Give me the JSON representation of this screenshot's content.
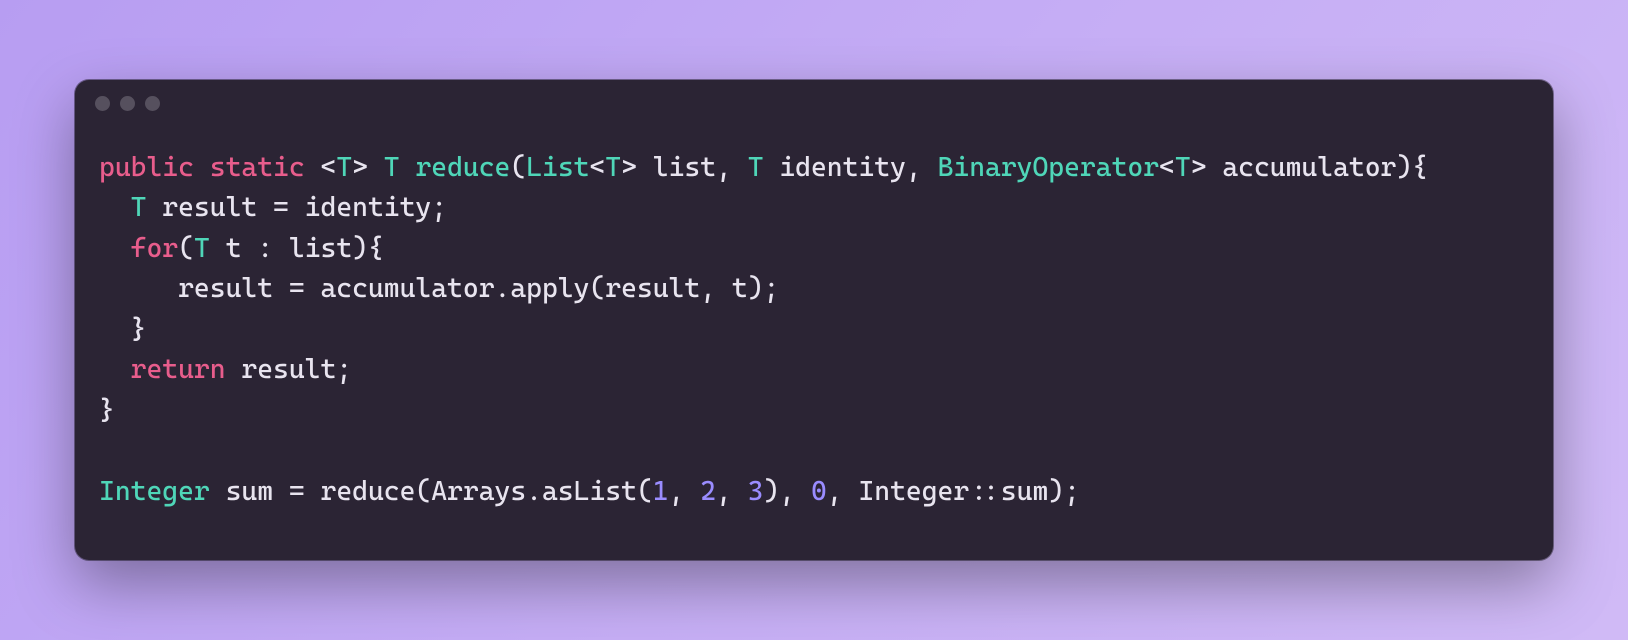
{
  "colors": {
    "bg_gradient_from": "#b79df2",
    "bg_gradient_to": "#d0baf6",
    "window_bg": "#2b2434",
    "dot": "#56505e",
    "text": "#e8e4ef",
    "keyword": "#e85d8c",
    "type": "#4fd6b8",
    "number": "#9a8cff"
  },
  "code": {
    "tokens": [
      [
        {
          "t": "public",
          "c": "keyword"
        },
        {
          "t": " ",
          "c": "plain"
        },
        {
          "t": "static",
          "c": "keyword"
        },
        {
          "t": " <",
          "c": "plain"
        },
        {
          "t": "T",
          "c": "type"
        },
        {
          "t": "> ",
          "c": "plain"
        },
        {
          "t": "T",
          "c": "type"
        },
        {
          "t": " ",
          "c": "plain"
        },
        {
          "t": "reduce",
          "c": "funcname"
        },
        {
          "t": "(",
          "c": "plain"
        },
        {
          "t": "List",
          "c": "type"
        },
        {
          "t": "<",
          "c": "plain"
        },
        {
          "t": "T",
          "c": "type"
        },
        {
          "t": "> list, ",
          "c": "plain"
        },
        {
          "t": "T",
          "c": "type"
        },
        {
          "t": " identity, ",
          "c": "plain"
        },
        {
          "t": "BinaryOperator",
          "c": "type"
        },
        {
          "t": "<",
          "c": "plain"
        },
        {
          "t": "T",
          "c": "type"
        },
        {
          "t": "> accumulator){",
          "c": "plain"
        }
      ],
      [
        {
          "t": "  ",
          "c": "plain"
        },
        {
          "t": "T",
          "c": "type"
        },
        {
          "t": " result = identity;",
          "c": "plain"
        }
      ],
      [
        {
          "t": "  ",
          "c": "plain"
        },
        {
          "t": "for",
          "c": "keyword"
        },
        {
          "t": "(",
          "c": "plain"
        },
        {
          "t": "T",
          "c": "type"
        },
        {
          "t": " t : list){",
          "c": "plain"
        }
      ],
      [
        {
          "t": "     result = accumulator.apply(result, t);",
          "c": "plain"
        }
      ],
      [
        {
          "t": "  }",
          "c": "plain"
        }
      ],
      [
        {
          "t": "  ",
          "c": "plain"
        },
        {
          "t": "return",
          "c": "keyword"
        },
        {
          "t": " result;",
          "c": "plain"
        }
      ],
      [
        {
          "t": "}",
          "c": "plain"
        }
      ],
      [
        {
          "t": "",
          "c": "plain"
        }
      ],
      [
        {
          "t": "Integer",
          "c": "type"
        },
        {
          "t": " sum = reduce(Arrays.asList(",
          "c": "plain"
        },
        {
          "t": "1",
          "c": "number"
        },
        {
          "t": ", ",
          "c": "plain"
        },
        {
          "t": "2",
          "c": "number"
        },
        {
          "t": ", ",
          "c": "plain"
        },
        {
          "t": "3",
          "c": "number"
        },
        {
          "t": "), ",
          "c": "plain"
        },
        {
          "t": "0",
          "c": "number"
        },
        {
          "t": ", Integer::sum);",
          "c": "plain"
        }
      ]
    ]
  }
}
